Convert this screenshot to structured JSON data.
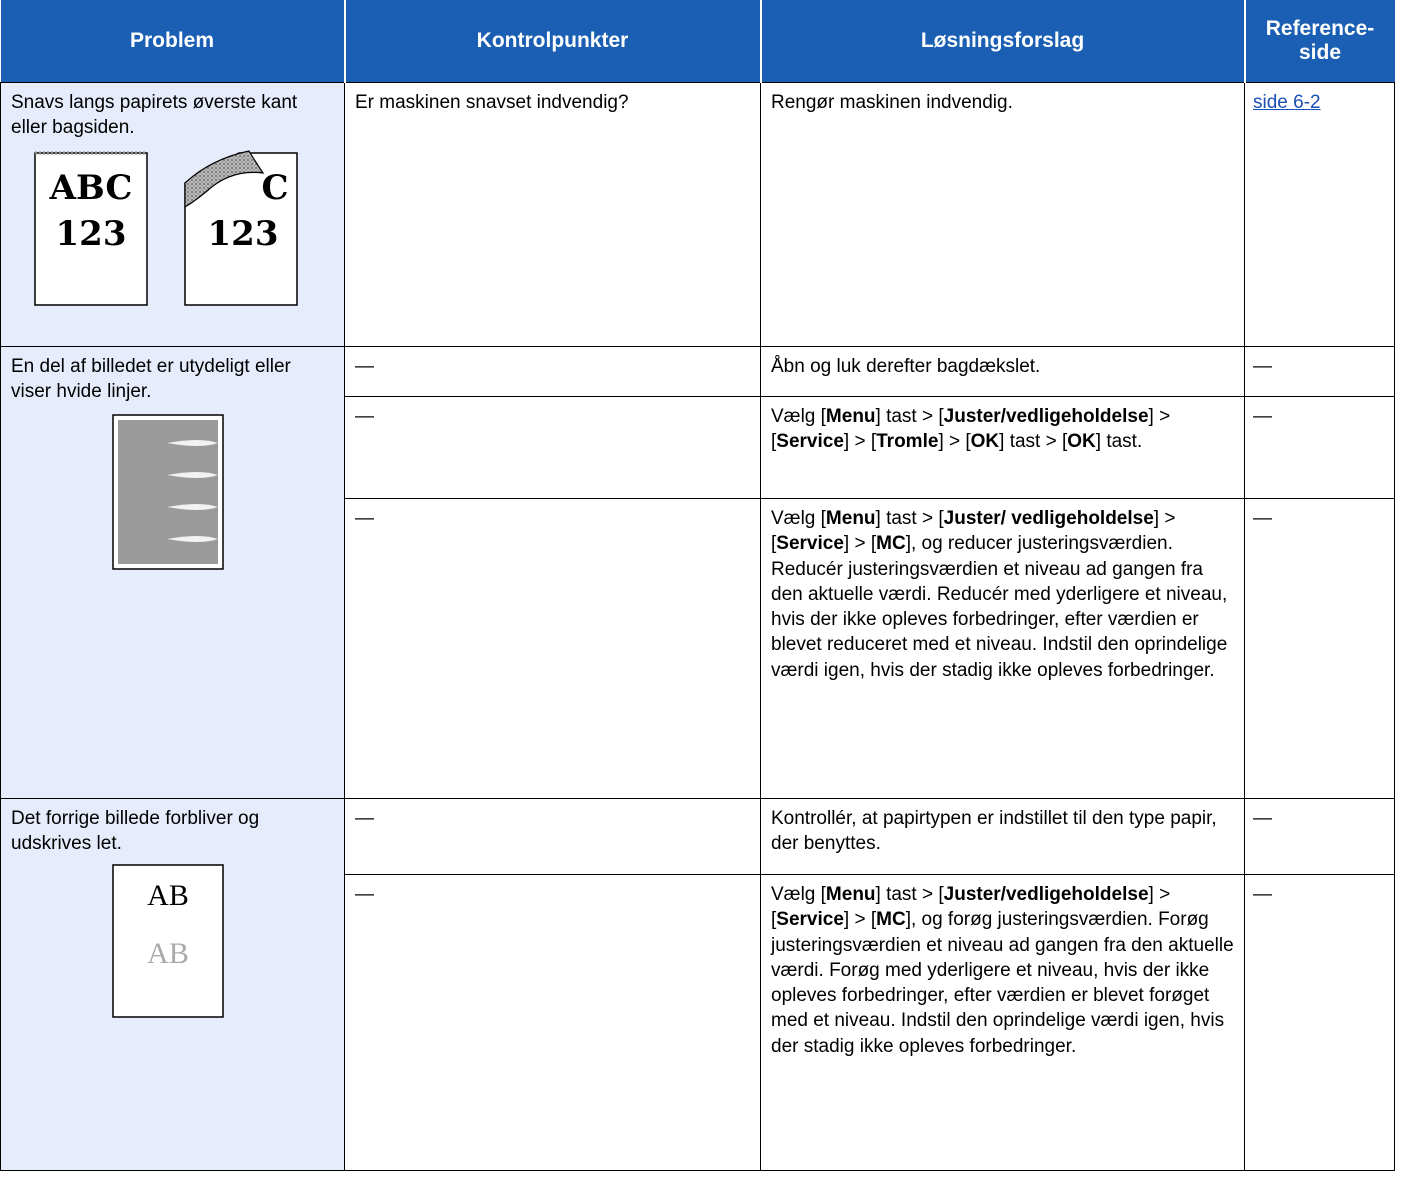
{
  "header": {
    "col_problem": "Problem",
    "col_check": "Kontrolpunkter",
    "col_solution": "Løsningsforslag",
    "col_ref_line1": "Reference-",
    "col_ref_line2": "side"
  },
  "rows": [
    {
      "problem": "Snavs langs papirets øverste kant eller bagsiden.",
      "illustration": {
        "page1_line1": "ABC",
        "page1_line2": "123",
        "page2_line1": "C",
        "page2_line2": "123"
      },
      "check": "Er maskinen snavset indvendig?",
      "solution": "Rengør maskinen indvendig.",
      "ref": "side 6-2"
    },
    {
      "problem": "En del af billedet er utydeligt eller viser hvide linjer.",
      "subrows": [
        {
          "check": "—",
          "solution": "Åbn og luk derefter bagdækslet.",
          "ref": "—"
        },
        {
          "check": "—",
          "solution_parts": {
            "t1": "Vælg [",
            "menu": "Menu",
            "t2": "] tast > [",
            "juster": "Juster/vedligeholdelse",
            "t3": "] > [",
            "service": "Service",
            "t4": "] > [",
            "tromle": "Tromle",
            "t5": "] > [",
            "ok1": "OK",
            "t6": "] tast > [",
            "ok2": "OK",
            "t7": "] tast."
          },
          "ref": "—"
        },
        {
          "check": "—",
          "solution_parts": {
            "t1": "Vælg [",
            "menu": "Menu",
            "t2": "] tast > [",
            "juster": "Juster/ vedligeholdelse",
            "t3": "] > [",
            "service": "Service",
            "t4": "] > [",
            "mc": "MC",
            "t5": "], og reducer justeringsværdien. Reducér justeringsværdien et niveau ad gangen fra den aktuelle værdi. Reducér med yderligere et niveau, hvis der ikke opleves forbedringer, efter værdien er blevet reduceret med et niveau. Indstil den oprindelige værdi igen, hvis der stadig ikke opleves forbedringer."
          },
          "ref": "—"
        }
      ]
    },
    {
      "problem": "Det forrige billede forbliver og udskrives let.",
      "illustration": {
        "line1": "AB",
        "line2": "AB"
      },
      "subrows": [
        {
          "check": "—",
          "solution": "Kontrollér, at papirtypen er indstillet til den type papir, der benyttes.",
          "ref": "—"
        },
        {
          "check": "—",
          "solution_parts": {
            "t1": "Vælg [",
            "menu": "Menu",
            "t2": "] tast > [",
            "juster": "Juster/vedligeholdelse",
            "t3": "] > [",
            "service": "Service",
            "t4": "] > [",
            "mc": "MC",
            "t5": "], og forøg justeringsværdien. Forøg justeringsværdien et niveau ad gangen fra den aktuelle værdi. Forøg med yderligere et niveau, hvis der ikke opleves forbedringer, efter værdien er blevet forøget med et niveau. Indstil den oprindelige værdi igen, hvis der stadig ikke opleves forbedringer."
          },
          "ref": "—"
        }
      ]
    }
  ],
  "colors": {
    "header_bg": "#1a5fb4",
    "problem_bg": "#e6ecfb",
    "link": "#1a4fb4"
  }
}
